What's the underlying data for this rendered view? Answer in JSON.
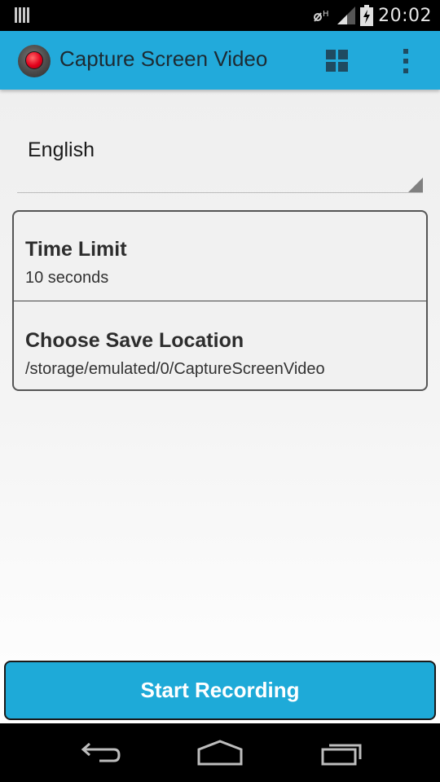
{
  "status_bar": {
    "time": "20:02",
    "icons": [
      "barcode-icon",
      "nfc-icon",
      "signal-icon",
      "battery-charging-icon"
    ]
  },
  "action_bar": {
    "app_icon": "record-camera-icon",
    "title": "Capture Screen Video",
    "grid_icon": "grid-icon",
    "overflow_icon": "overflow-menu-icon"
  },
  "language_spinner": {
    "value": "English"
  },
  "settings": [
    {
      "title": "Time Limit",
      "summary": "10 seconds"
    },
    {
      "title": "Choose Save Location",
      "summary": "/storage/emulated/0/CaptureScreenVideo"
    }
  ],
  "start_button": {
    "label": "Start Recording"
  },
  "nav_bar": {
    "icons": [
      "back-icon",
      "home-icon",
      "recents-icon"
    ]
  },
  "colors": {
    "accent": "#22aadb",
    "button": "#1eaad8"
  }
}
